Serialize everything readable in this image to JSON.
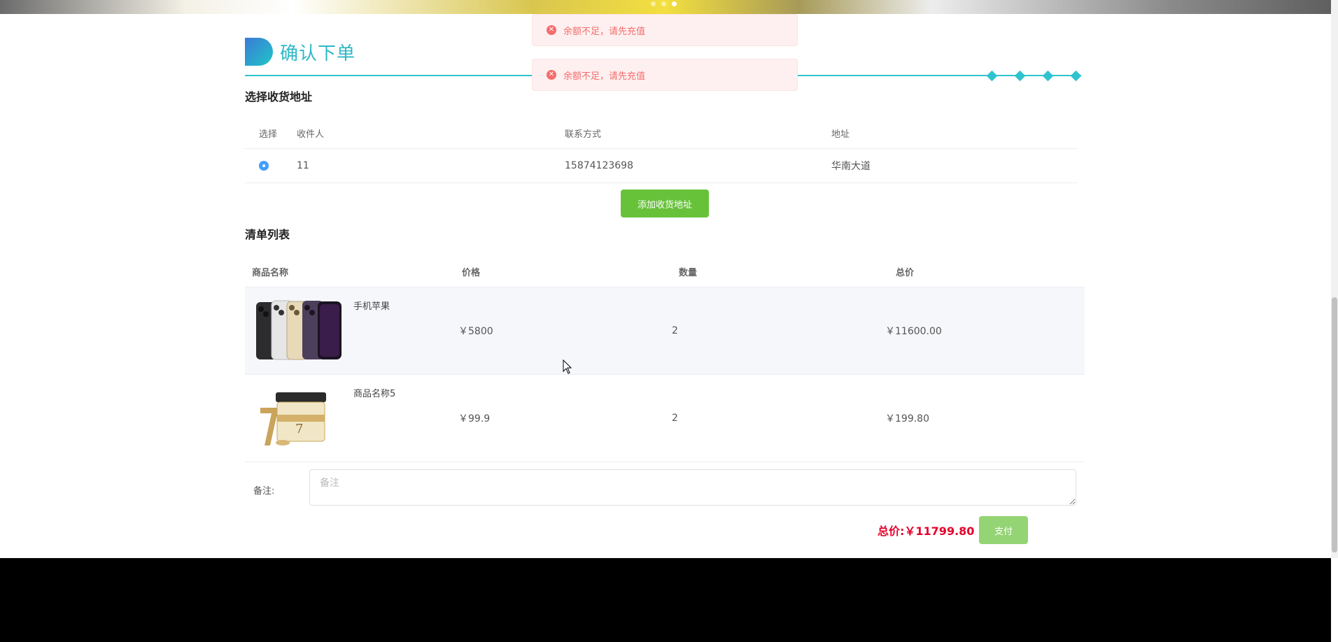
{
  "heading": {
    "title": "确认下单"
  },
  "address_section": {
    "title": "选择收货地址",
    "columns": [
      "选择",
      "收件人",
      "联系方式",
      "地址"
    ],
    "rows": [
      {
        "name": "11",
        "phone": "15874123698",
        "address": "华南大道",
        "selected": true
      }
    ],
    "add_button": "添加收货地址"
  },
  "items_section": {
    "title": "清单列表",
    "columns": [
      "商品名称",
      "价格",
      "数量",
      "总价"
    ],
    "items": [
      {
        "name": "手机苹果",
        "price": "￥5800",
        "qty": "2",
        "total": "￥11600.00"
      },
      {
        "name": "商品名称5",
        "price": "￥99.9",
        "qty": "2",
        "total": "￥199.80"
      }
    ]
  },
  "remark": {
    "label": "备注:",
    "placeholder": "备注"
  },
  "summary": {
    "total_label": "总价:",
    "total_value": "￥11799.80",
    "pay_button": "支付"
  },
  "toasts": [
    {
      "message": "余额不足，请先充值"
    },
    {
      "message": "余额不足，请先充值"
    }
  ],
  "colors": {
    "accent": "#2fc3cf",
    "success_button": "#67c23a",
    "pay_button": "#95d475",
    "error": "#f56c6c",
    "total_text": "#e4002b"
  }
}
